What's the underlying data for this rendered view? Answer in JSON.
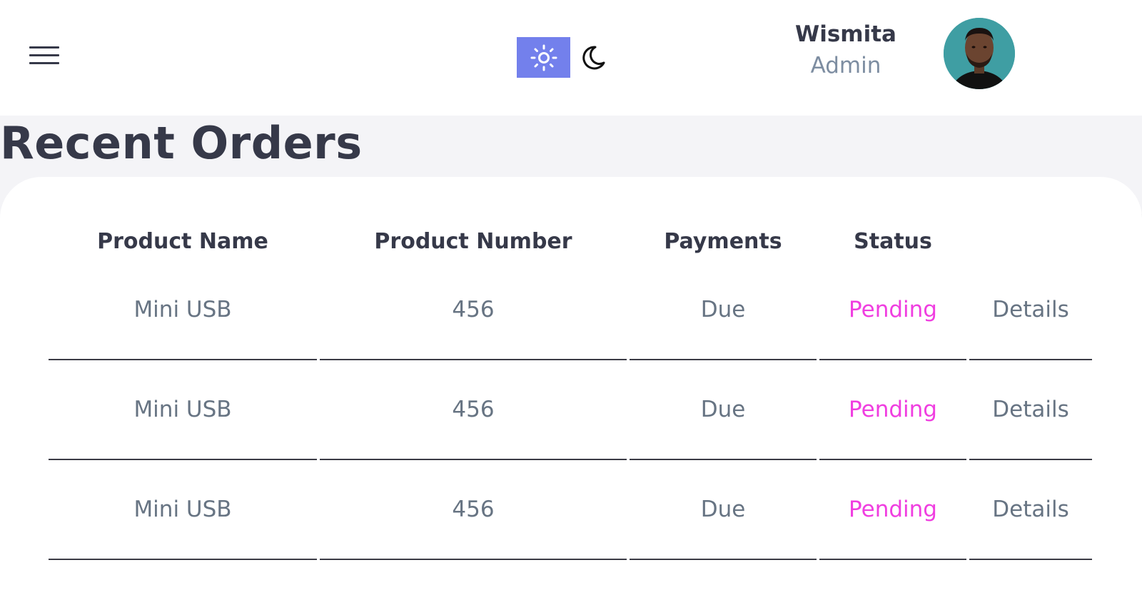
{
  "header": {
    "menu_icon": "hamburger-menu-icon",
    "theme": {
      "light_icon": "sun-icon",
      "dark_icon": "moon-icon",
      "active": "light",
      "active_color": "#7380ec"
    },
    "profile": {
      "name": "Wismita",
      "role": "Admin",
      "avatar_icon": "user-avatar-photo"
    }
  },
  "page": {
    "title": "Recent Orders"
  },
  "table": {
    "columns": [
      "Product Name",
      "Product Number",
      "Payments",
      "Status"
    ],
    "rows": [
      {
        "product_name": "Mini USB",
        "product_number": "456",
        "payment": "Due",
        "status": "Pending",
        "action": "Details"
      },
      {
        "product_name": "Mini USB",
        "product_number": "456",
        "payment": "Due",
        "status": "Pending",
        "action": "Details"
      },
      {
        "product_name": "Mini USB",
        "product_number": "456",
        "payment": "Due",
        "status": "Pending",
        "action": "Details"
      }
    ]
  },
  "colors": {
    "primary": "#7380ec",
    "pending": "#f03ee0",
    "dark_text": "#363949",
    "muted_text": "#677483"
  }
}
